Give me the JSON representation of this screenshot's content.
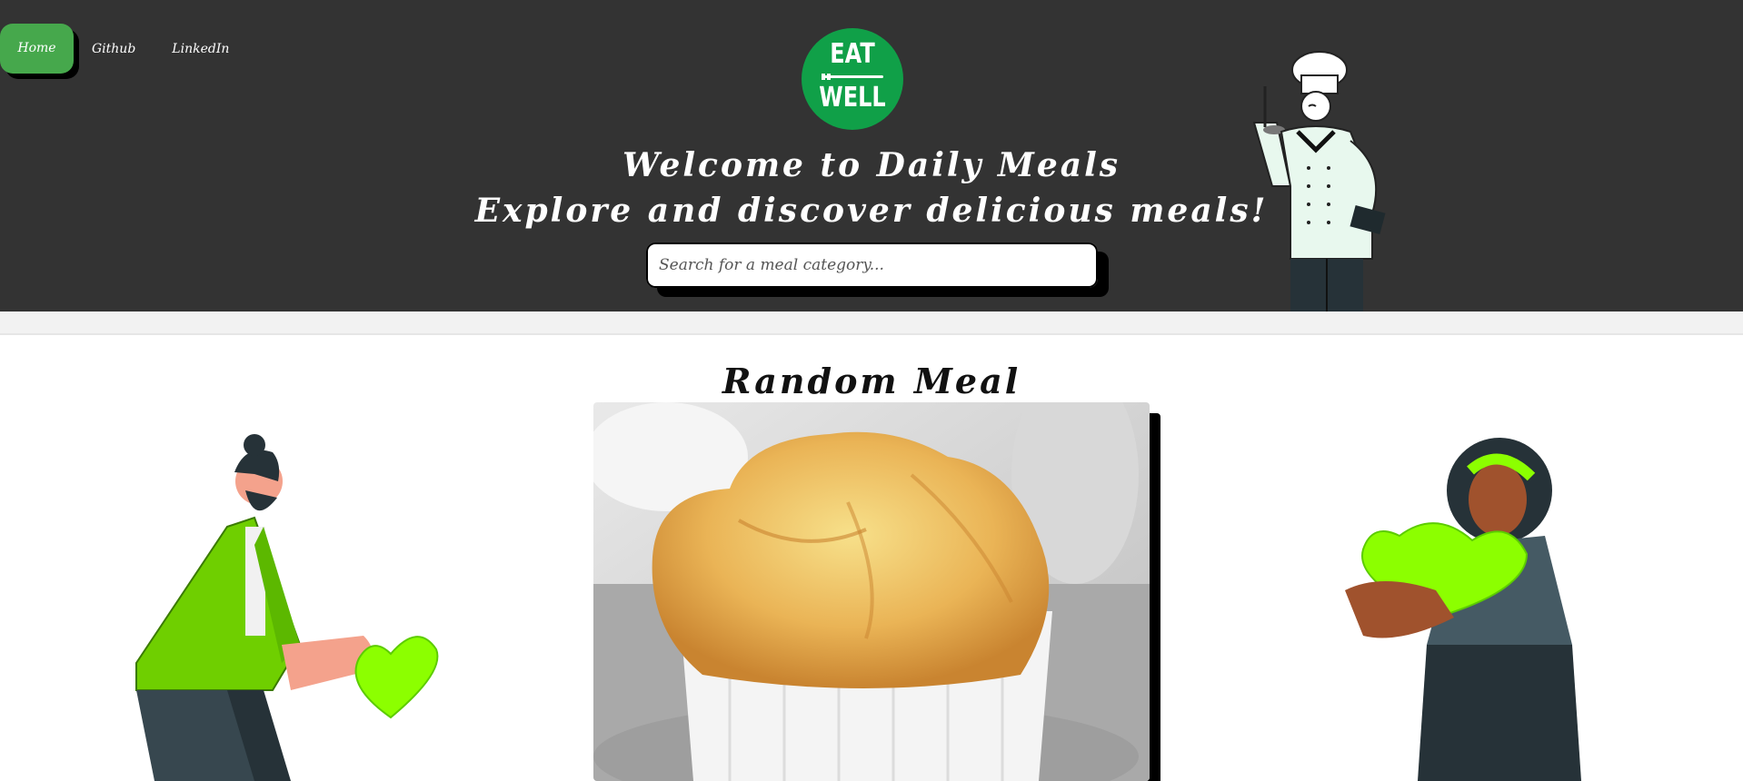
{
  "nav": {
    "home": "Home",
    "github": "Github",
    "linkedin": "LinkedIn"
  },
  "logo": {
    "line1": "EAT",
    "line2": "WELL"
  },
  "hero": {
    "title": "Welcome to Daily Meals",
    "subtitle": "Explore and discover delicious meals!"
  },
  "search": {
    "placeholder": "Search for a meal category...",
    "value": ""
  },
  "random": {
    "title": "Random Meal"
  },
  "colors": {
    "header_bg": "#333333",
    "accent_green": "#46a84c",
    "logo_green": "#10a048",
    "heart_green": "#8cff00"
  },
  "icons": [
    "chef-illustration",
    "man-with-heart-illustration",
    "woman-with-heart-illustration",
    "fork-icon"
  ]
}
